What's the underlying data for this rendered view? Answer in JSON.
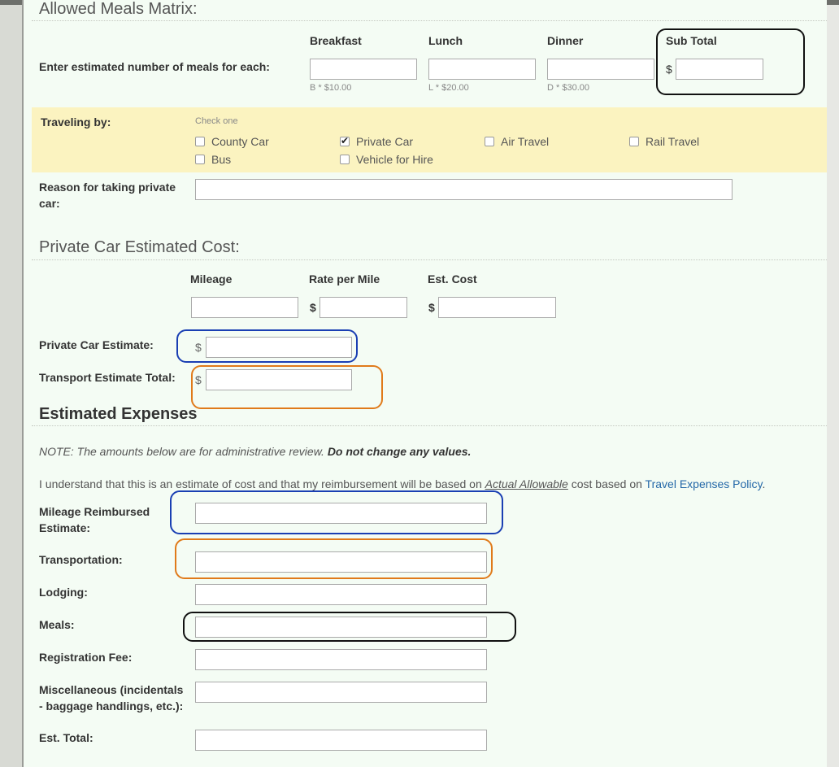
{
  "meals_matrix": {
    "title": "Allowed Meals Matrix:",
    "row_label": "Enter estimated number of meals for each:",
    "columns": [
      {
        "label": "Breakfast",
        "value": "",
        "hint": "B * $10.00"
      },
      {
        "label": "Lunch",
        "value": "",
        "hint": "L * $20.00"
      },
      {
        "label": "Dinner",
        "value": "",
        "hint": "D * $30.00"
      }
    ],
    "subtotal": {
      "label": "Sub Total",
      "currency": "$",
      "value": ""
    }
  },
  "traveling": {
    "label": "Traveling by:",
    "hint": "Check one",
    "options": [
      {
        "label": "County Car",
        "checked": false
      },
      {
        "label": "Private Car",
        "checked": true
      },
      {
        "label": "Air Travel",
        "checked": false
      },
      {
        "label": "Rail Travel",
        "checked": false
      },
      {
        "label": "Bus",
        "checked": false
      },
      {
        "label": "Vehicle for Hire",
        "checked": false
      }
    ]
  },
  "reason": {
    "label": "Reason for taking private car:",
    "label_line1": "Reason for taking private",
    "label_line2": "car:",
    "value": ""
  },
  "private_car": {
    "title": "Private Car Estimated Cost:",
    "mileage_label": "Mileage",
    "rate_label": "Rate per Mile",
    "cost_label": "Est. Cost",
    "currency": "$",
    "estimate_label": "Private Car Estimate:",
    "transport_total_label": "Transport Estimate Total:"
  },
  "expenses": {
    "title": "Estimated Expenses",
    "note_prefix": "NOTE: The amounts below are for administrative review. ",
    "note_bold": "Do not change any values.",
    "understand_prefix": "I understand that this is an estimate of cost and that my reimbursement will be based on ",
    "understand_emph": "Actual Allowable",
    "understand_mid": " cost based on ",
    "policy_link": "Travel Expenses Policy",
    "understand_suffix": ".",
    "fields": {
      "mileage_line1": "Mileage Reimbursed",
      "mileage_line2": "Estimate:",
      "transportation": "Transportation:",
      "lodging": "Lodging:",
      "meals": "Meals:",
      "registration": "Registration Fee:",
      "misc_line1": "Miscellaneous (incidentals",
      "misc_line2": "- baggage handlings, etc.):",
      "total": "Est. Total:"
    }
  },
  "colors": {
    "page_bg": "#f4fcf4",
    "highlight_yellow": "#fbf3c0",
    "ring_black": "#111111",
    "ring_blue": "#1a3fb3",
    "ring_orange": "#e07a1a",
    "link": "#2468a8"
  }
}
